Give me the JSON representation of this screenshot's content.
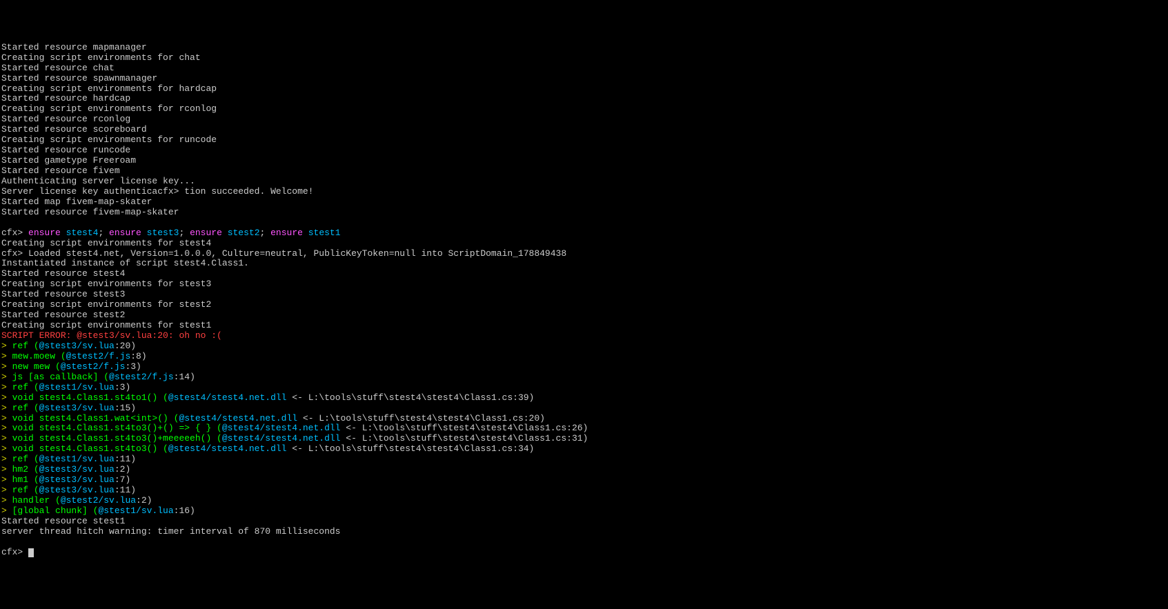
{
  "lines": [
    {
      "segs": [
        {
          "t": "Started resource mapmanager",
          "c": "white"
        }
      ]
    },
    {
      "segs": [
        {
          "t": "Creating script environments for chat",
          "c": "white"
        }
      ]
    },
    {
      "segs": [
        {
          "t": "Started resource chat",
          "c": "white"
        }
      ]
    },
    {
      "segs": [
        {
          "t": "Started resource spawnmanager",
          "c": "white"
        }
      ]
    },
    {
      "segs": [
        {
          "t": "Creating script environments for hardcap",
          "c": "white"
        }
      ]
    },
    {
      "segs": [
        {
          "t": "Started resource hardcap",
          "c": "white"
        }
      ]
    },
    {
      "segs": [
        {
          "t": "Creating script environments for rconlog",
          "c": "white"
        }
      ]
    },
    {
      "segs": [
        {
          "t": "Started resource rconlog",
          "c": "white"
        }
      ]
    },
    {
      "segs": [
        {
          "t": "Started resource scoreboard",
          "c": "white"
        }
      ]
    },
    {
      "segs": [
        {
          "t": "Creating script environments for runcode",
          "c": "white"
        }
      ]
    },
    {
      "segs": [
        {
          "t": "Started resource runcode",
          "c": "white"
        }
      ]
    },
    {
      "segs": [
        {
          "t": "Started gametype Freeroam",
          "c": "white"
        }
      ]
    },
    {
      "segs": [
        {
          "t": "Started resource fivem",
          "c": "white"
        }
      ]
    },
    {
      "segs": [
        {
          "t": "Authenticating server license key...",
          "c": "white"
        }
      ]
    },
    {
      "segs": [
        {
          "t": "Server license key authenticacfx> tion succeeded. Welcome!",
          "c": "white"
        }
      ]
    },
    {
      "segs": [
        {
          "t": "Started map fivem-map-skater",
          "c": "white"
        }
      ]
    },
    {
      "segs": [
        {
          "t": "Started resource fivem-map-skater",
          "c": "white"
        }
      ]
    },
    {
      "segs": [
        {
          "t": " ",
          "c": "white"
        }
      ]
    },
    {
      "segs": [
        {
          "t": "cfx> ",
          "c": "white"
        },
        {
          "t": "ensure ",
          "c": "magenta"
        },
        {
          "t": "stest4",
          "c": "cyan"
        },
        {
          "t": "; ",
          "c": "white"
        },
        {
          "t": "ensure ",
          "c": "magenta"
        },
        {
          "t": "stest3",
          "c": "cyan"
        },
        {
          "t": "; ",
          "c": "white"
        },
        {
          "t": "ensure ",
          "c": "magenta"
        },
        {
          "t": "stest2",
          "c": "cyan"
        },
        {
          "t": "; ",
          "c": "white"
        },
        {
          "t": "ensure ",
          "c": "magenta"
        },
        {
          "t": "stest1",
          "c": "cyan"
        }
      ]
    },
    {
      "segs": [
        {
          "t": "Creating script environments for stest4",
          "c": "white"
        }
      ]
    },
    {
      "segs": [
        {
          "t": "cfx> Loaded stest4.net, Version=1.0.0.0, Culture=neutral, PublicKeyToken=null into ScriptDomain_178849438",
          "c": "white"
        }
      ]
    },
    {
      "segs": [
        {
          "t": "Instantiated instance of script stest4.Class1.",
          "c": "white"
        }
      ]
    },
    {
      "segs": [
        {
          "t": "Started resource stest4",
          "c": "white"
        }
      ]
    },
    {
      "segs": [
        {
          "t": "Creating script environments for stest3",
          "c": "white"
        }
      ]
    },
    {
      "segs": [
        {
          "t": "Started resource stest3",
          "c": "white"
        }
      ]
    },
    {
      "segs": [
        {
          "t": "Creating script environments for stest2",
          "c": "white"
        }
      ]
    },
    {
      "segs": [
        {
          "t": "Started resource stest2",
          "c": "white"
        }
      ]
    },
    {
      "segs": [
        {
          "t": "Creating script environments for stest1",
          "c": "white"
        }
      ]
    },
    {
      "segs": [
        {
          "t": "SCRIPT ERROR: @stest3/sv.lua:20: oh no :(",
          "c": "red"
        }
      ]
    },
    {
      "segs": [
        {
          "t": "> ",
          "c": "yellow"
        },
        {
          "t": "ref (",
          "c": "green"
        },
        {
          "t": "@stest3/sv.lua",
          "c": "cyan"
        },
        {
          "t": ":20)",
          "c": "white"
        }
      ]
    },
    {
      "segs": [
        {
          "t": "> ",
          "c": "yellow"
        },
        {
          "t": "mew.moew (",
          "c": "green"
        },
        {
          "t": "@stest2/f.js",
          "c": "cyan"
        },
        {
          "t": ":8)",
          "c": "white"
        }
      ]
    },
    {
      "segs": [
        {
          "t": "> ",
          "c": "yellow"
        },
        {
          "t": "new mew (",
          "c": "green"
        },
        {
          "t": "@stest2/f.js",
          "c": "cyan"
        },
        {
          "t": ":3)",
          "c": "white"
        }
      ]
    },
    {
      "segs": [
        {
          "t": "> ",
          "c": "yellow"
        },
        {
          "t": "js [as callback] (",
          "c": "green"
        },
        {
          "t": "@stest2/f.js",
          "c": "cyan"
        },
        {
          "t": ":14)",
          "c": "white"
        }
      ]
    },
    {
      "segs": [
        {
          "t": "> ",
          "c": "yellow"
        },
        {
          "t": "ref (",
          "c": "green"
        },
        {
          "t": "@stest1/sv.lua",
          "c": "cyan"
        },
        {
          "t": ":3)",
          "c": "white"
        }
      ]
    },
    {
      "segs": [
        {
          "t": "> ",
          "c": "yellow"
        },
        {
          "t": "void stest4.Class1.st4to1() (",
          "c": "green"
        },
        {
          "t": "@stest4/stest4.net.dll",
          "c": "cyan"
        },
        {
          "t": " <- L:\\tools\\stuff\\stest4\\stest4\\Class1.cs:39)",
          "c": "white"
        }
      ]
    },
    {
      "segs": [
        {
          "t": "> ",
          "c": "yellow"
        },
        {
          "t": "ref (",
          "c": "green"
        },
        {
          "t": "@stest3/sv.lua",
          "c": "cyan"
        },
        {
          "t": ":15)",
          "c": "white"
        }
      ]
    },
    {
      "segs": [
        {
          "t": "> ",
          "c": "yellow"
        },
        {
          "t": "void stest4.Class1.wat<int>() (",
          "c": "green"
        },
        {
          "t": "@stest4/stest4.net.dll",
          "c": "cyan"
        },
        {
          "t": " <- L:\\tools\\stuff\\stest4\\stest4\\Class1.cs:20)",
          "c": "white"
        }
      ]
    },
    {
      "segs": [
        {
          "t": "> ",
          "c": "yellow"
        },
        {
          "t": "void stest4.Class1.st4to3()+() => { } (",
          "c": "green"
        },
        {
          "t": "@stest4/stest4.net.dll",
          "c": "cyan"
        },
        {
          "t": " <- L:\\tools\\stuff\\stest4\\stest4\\Class1.cs:26)",
          "c": "white"
        }
      ]
    },
    {
      "segs": [
        {
          "t": "> ",
          "c": "yellow"
        },
        {
          "t": "void stest4.Class1.st4to3()+meeeeeh() (",
          "c": "green"
        },
        {
          "t": "@stest4/stest4.net.dll",
          "c": "cyan"
        },
        {
          "t": " <- L:\\tools\\stuff\\stest4\\stest4\\Class1.cs:31)",
          "c": "white"
        }
      ]
    },
    {
      "segs": [
        {
          "t": "> ",
          "c": "yellow"
        },
        {
          "t": "void stest4.Class1.st4to3() (",
          "c": "green"
        },
        {
          "t": "@stest4/stest4.net.dll",
          "c": "cyan"
        },
        {
          "t": " <- L:\\tools\\stuff\\stest4\\stest4\\Class1.cs:34)",
          "c": "white"
        }
      ]
    },
    {
      "segs": [
        {
          "t": "> ",
          "c": "yellow"
        },
        {
          "t": "ref (",
          "c": "green"
        },
        {
          "t": "@stest1/sv.lua",
          "c": "cyan"
        },
        {
          "t": ":11)",
          "c": "white"
        }
      ]
    },
    {
      "segs": [
        {
          "t": "> ",
          "c": "yellow"
        },
        {
          "t": "hm2 (",
          "c": "green"
        },
        {
          "t": "@stest3/sv.lua",
          "c": "cyan"
        },
        {
          "t": ":2)",
          "c": "white"
        }
      ]
    },
    {
      "segs": [
        {
          "t": "> ",
          "c": "yellow"
        },
        {
          "t": "hm1 (",
          "c": "green"
        },
        {
          "t": "@stest3/sv.lua",
          "c": "cyan"
        },
        {
          "t": ":7)",
          "c": "white"
        }
      ]
    },
    {
      "segs": [
        {
          "t": "> ",
          "c": "yellow"
        },
        {
          "t": "ref (",
          "c": "green"
        },
        {
          "t": "@stest3/sv.lua",
          "c": "cyan"
        },
        {
          "t": ":11)",
          "c": "white"
        }
      ]
    },
    {
      "segs": [
        {
          "t": "> ",
          "c": "yellow"
        },
        {
          "t": "handler (",
          "c": "green"
        },
        {
          "t": "@stest2/sv.lua",
          "c": "cyan"
        },
        {
          "t": ":2)",
          "c": "white"
        }
      ]
    },
    {
      "segs": [
        {
          "t": "> ",
          "c": "yellow"
        },
        {
          "t": "[global chunk] (",
          "c": "green"
        },
        {
          "t": "@stest1/sv.lua",
          "c": "cyan"
        },
        {
          "t": ":16)",
          "c": "white"
        }
      ]
    },
    {
      "segs": [
        {
          "t": "Started resource stest1",
          "c": "white"
        }
      ]
    },
    {
      "segs": [
        {
          "t": "server thread hitch warning: timer interval of 870 milliseconds",
          "c": "white"
        }
      ]
    },
    {
      "segs": [
        {
          "t": " ",
          "c": "white"
        }
      ]
    }
  ],
  "prompt": "cfx> "
}
